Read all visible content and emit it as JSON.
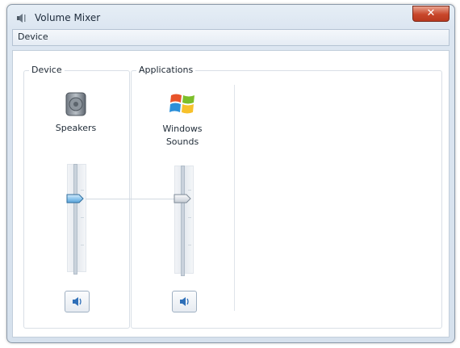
{
  "window": {
    "title": "Volume Mixer",
    "close_symbol": "✕"
  },
  "menu": {
    "device": "Device"
  },
  "groups": {
    "device_label": "Device",
    "applications_label": "Applications"
  },
  "channels": [
    {
      "name": "Speakers",
      "icon": "speaker-icon",
      "volume_fraction": 0.7,
      "muted": false
    },
    {
      "name_line1": "Windows",
      "name_line2": "Sounds",
      "icon": "windows-logo-icon",
      "volume_fraction": 0.7,
      "muted": false
    }
  ]
}
